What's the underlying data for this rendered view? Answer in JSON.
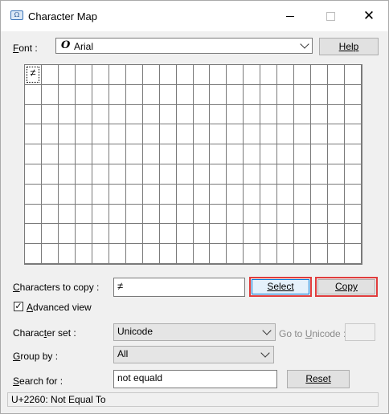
{
  "window": {
    "title": "Character Map",
    "close_glyph": "✕"
  },
  "font": {
    "label_prefix": "F",
    "label_rest": "ont :",
    "value": "Arial",
    "glyph": "O"
  },
  "help": {
    "label": "Help"
  },
  "grid": {
    "selected_char": "≠",
    "rows": 10,
    "cols": 20
  },
  "copy_section": {
    "label_prefix": "C",
    "label_rest": "haracters to copy :",
    "value": "≠",
    "select_label": "Select",
    "copy_label": "Copy"
  },
  "advanced": {
    "checked_glyph": "✓",
    "label_prefix": "A",
    "label_rest": "dvanced view"
  },
  "character_set": {
    "label_a": "Charac",
    "label_u": "t",
    "label_b": "er set :",
    "value": "Unicode"
  },
  "go_to_unicode": {
    "label_a": "Go to ",
    "label_u": "U",
    "label_b": "nicode :",
    "value": ""
  },
  "group_by": {
    "label_prefix": "G",
    "label_rest": "roup by :",
    "value": "All"
  },
  "search": {
    "label_prefix": "S",
    "label_rest": "earch for :",
    "value": "not equald",
    "reset_label": "Reset"
  },
  "status": {
    "text": "U+2260: Not Equal To"
  },
  "colors": {
    "highlight": "#e03c3c",
    "accent": "#0078d7"
  }
}
